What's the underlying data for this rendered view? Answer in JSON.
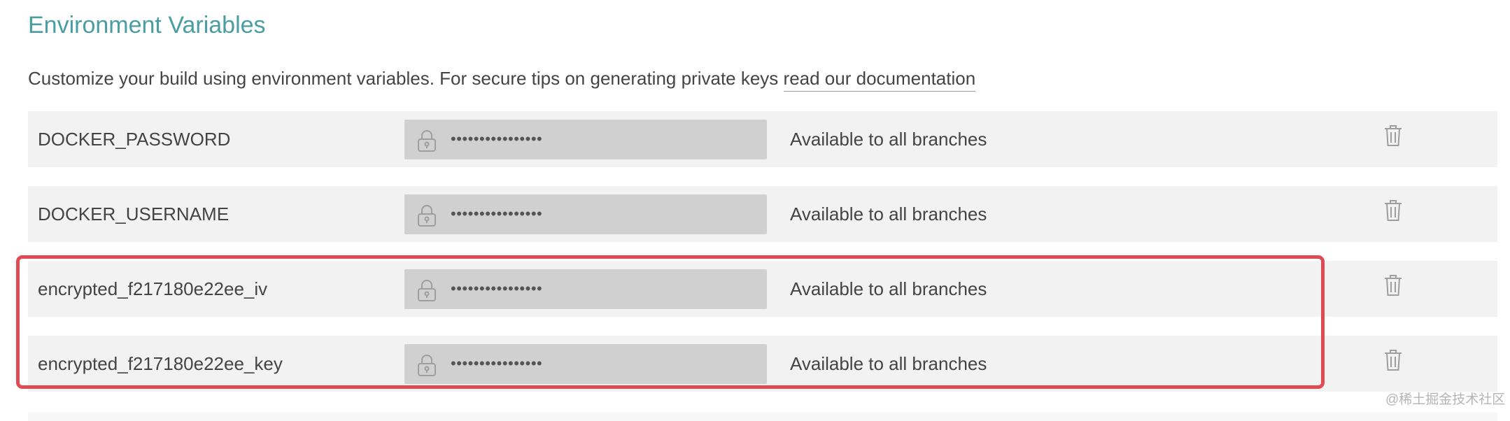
{
  "section": {
    "title": "Environment Variables",
    "description": "Customize your build using environment variables. For secure tips on generating private keys ",
    "doc_link": "read our documentation"
  },
  "env_vars": [
    {
      "name": "DOCKER_PASSWORD",
      "value": "••••••••••••••••",
      "availability": "Available to all branches",
      "value_icon": "lock-icon",
      "action_icon": "trash-icon"
    },
    {
      "name": "DOCKER_USERNAME",
      "value": "••••••••••••••••",
      "availability": "Available to all branches",
      "value_icon": "lock-icon",
      "action_icon": "trash-icon"
    },
    {
      "name": "encrypted_f217180e22ee_iv",
      "value": "••••••••••••••••",
      "availability": "Available to all branches",
      "value_icon": "lock-icon",
      "action_icon": "trash-icon"
    },
    {
      "name": "encrypted_f217180e22ee_key",
      "value": "••••••••••••••••",
      "availability": "Available to all branches",
      "value_icon": "lock-icon",
      "action_icon": "trash-icon"
    }
  ],
  "watermark": "@稀土掘金技术社区",
  "colors": {
    "title": "#4a9ea1",
    "row_background": "#f2f2f2",
    "value_box": "#d0d0d0",
    "highlight": "#e04a52",
    "text": "#444444"
  }
}
